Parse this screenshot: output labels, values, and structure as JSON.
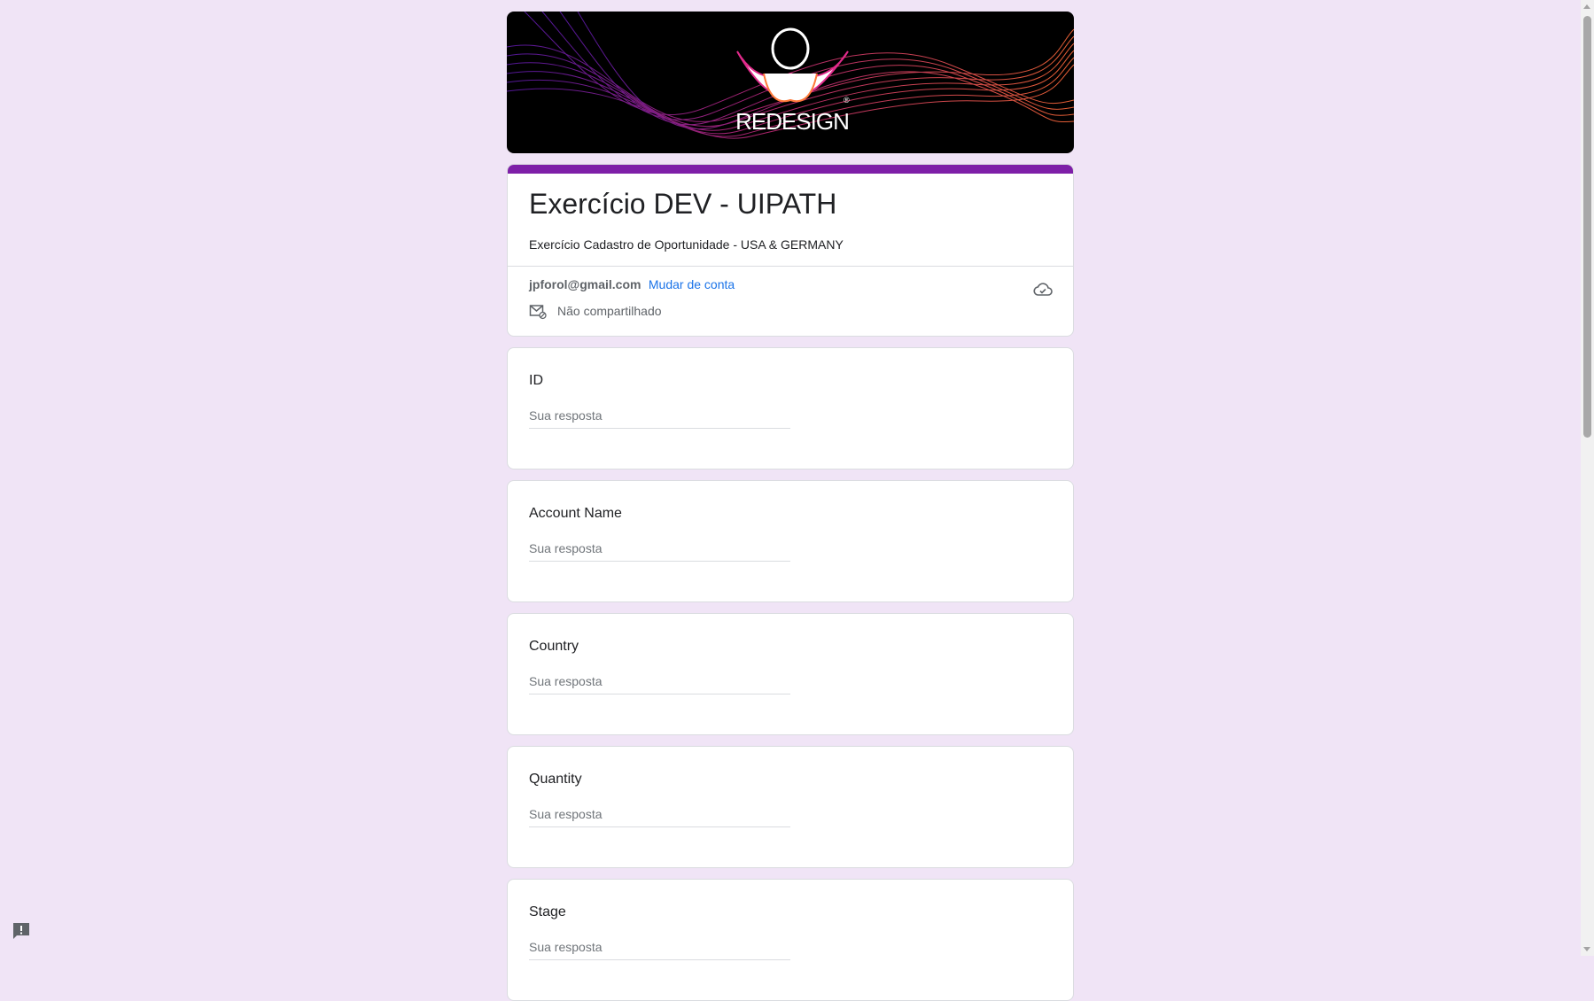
{
  "banner": {
    "logo_text": "REDESIGN"
  },
  "form": {
    "title": "Exercício DEV - UIPATH",
    "description": "Exercício Cadastro de Oportunidade - USA & GERMANY",
    "accent_color": "#7e1fa8",
    "account_email": "jpforol@gmail.com",
    "switch_account": "Mudar de conta",
    "share_status": "Não compartilhado"
  },
  "questions": [
    {
      "label": "ID",
      "placeholder": "Sua resposta"
    },
    {
      "label": "Account Name",
      "placeholder": "Sua resposta"
    },
    {
      "label": "Country",
      "placeholder": "Sua resposta"
    },
    {
      "label": "Quantity",
      "placeholder": "Sua resposta"
    },
    {
      "label": "Stage",
      "placeholder": "Sua resposta"
    }
  ],
  "icons": {
    "cloud": "cloud-icon",
    "mail": "mail-icon",
    "feedback": "feedback-icon"
  },
  "colors": {
    "background": "#f0e4f6",
    "link": "#1a73e8"
  }
}
